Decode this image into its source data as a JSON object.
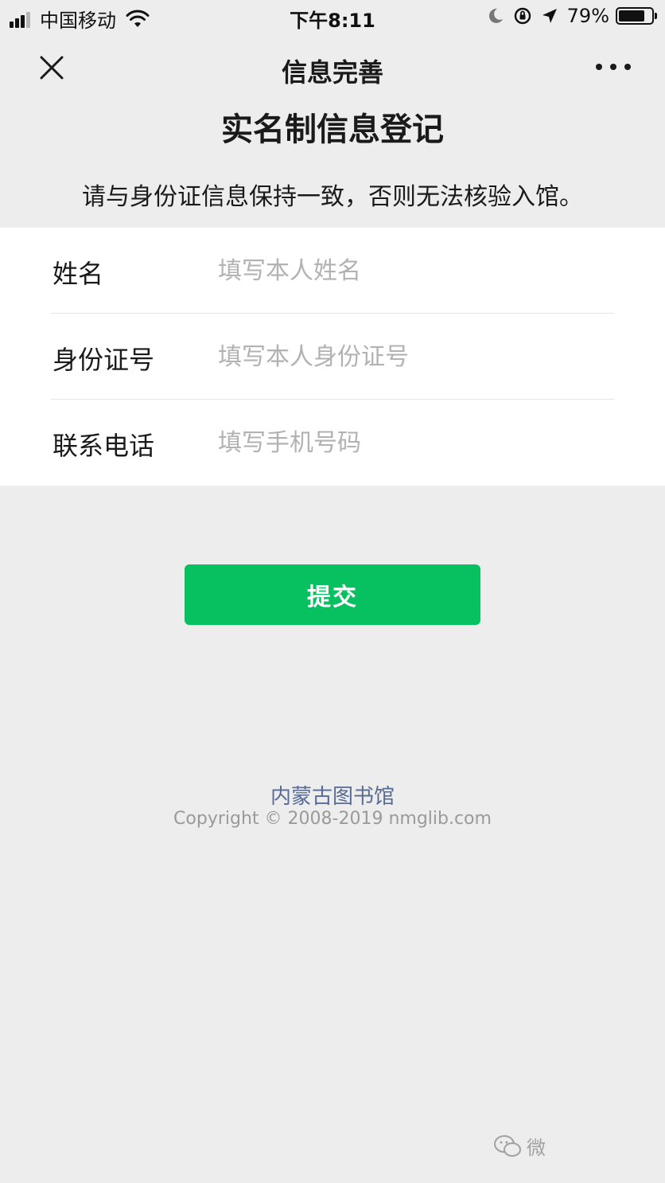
{
  "status_bar": {
    "carrier": "中国移动",
    "time": "下午8:11",
    "battery_percent": "79%",
    "battery_level": 0.79,
    "icons": [
      "signal-icon",
      "wifi-icon",
      "moon-icon",
      "rotation-lock-icon",
      "location-icon",
      "battery-icon"
    ]
  },
  "nav": {
    "title": "信息完善",
    "close_icon": "close-icon",
    "more_icon": "more-icon"
  },
  "page": {
    "heading": "实名制信息登记",
    "notice": "请与身份证信息保持一致，否则无法核验入馆。"
  },
  "form": {
    "fields": [
      {
        "label": "姓名",
        "placeholder": "填写本人姓名",
        "value": ""
      },
      {
        "label": "身份证号",
        "placeholder": "填写本人身份证号",
        "value": ""
      },
      {
        "label": "联系电话",
        "placeholder": "填写手机号码",
        "value": ""
      }
    ]
  },
  "actions": {
    "submit_label": "提交"
  },
  "footer": {
    "organization": "内蒙古图书馆",
    "copyright": "Copyright © 2008-2019 nmglib.com"
  },
  "watermark": {
    "icon": "wechat-icon",
    "text": "微"
  },
  "colors": {
    "accent": "#07c160",
    "link": "#576b95",
    "background": "#ededed"
  }
}
